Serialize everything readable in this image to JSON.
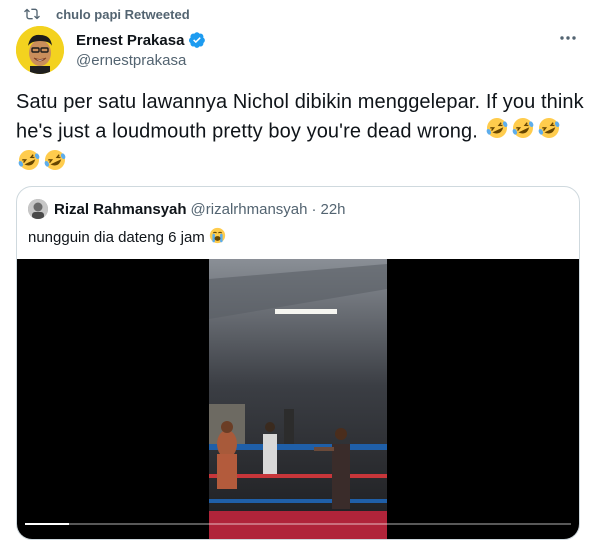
{
  "retweet": {
    "icon": "retweet-icon",
    "label": "chulo papi Retweeted"
  },
  "author": {
    "name": "Ernest Prakasa",
    "handle": "@ernestprakasa",
    "verified": true,
    "verified_color": "#1d9bf0"
  },
  "more_icon": "more-options-icon",
  "tweet": {
    "text": "Satu per satu lawannya Nichol dibikin menggelepar. If you think he's just a loudmouth pretty boy you're dead wrong.",
    "emojis": [
      "rolling-on-floor-laughing-emoji",
      "rolling-on-floor-laughing-emoji",
      "rolling-on-floor-laughing-emoji",
      "rolling-on-floor-laughing-emoji",
      "rolling-on-floor-laughing-emoji"
    ]
  },
  "quote": {
    "name": "Rizal Rahmansyah",
    "handle": "@rizalrhmansyah",
    "separator": "·",
    "time": "22h",
    "text": "nungguin dia dateng 6 jam",
    "emoji": "loudly-crying-face-emoji",
    "video": {
      "progress_fraction": 0.08
    }
  },
  "colors": {
    "secondary_text": "#536471",
    "border": "#cfd9de",
    "video_bg": "#000000"
  }
}
